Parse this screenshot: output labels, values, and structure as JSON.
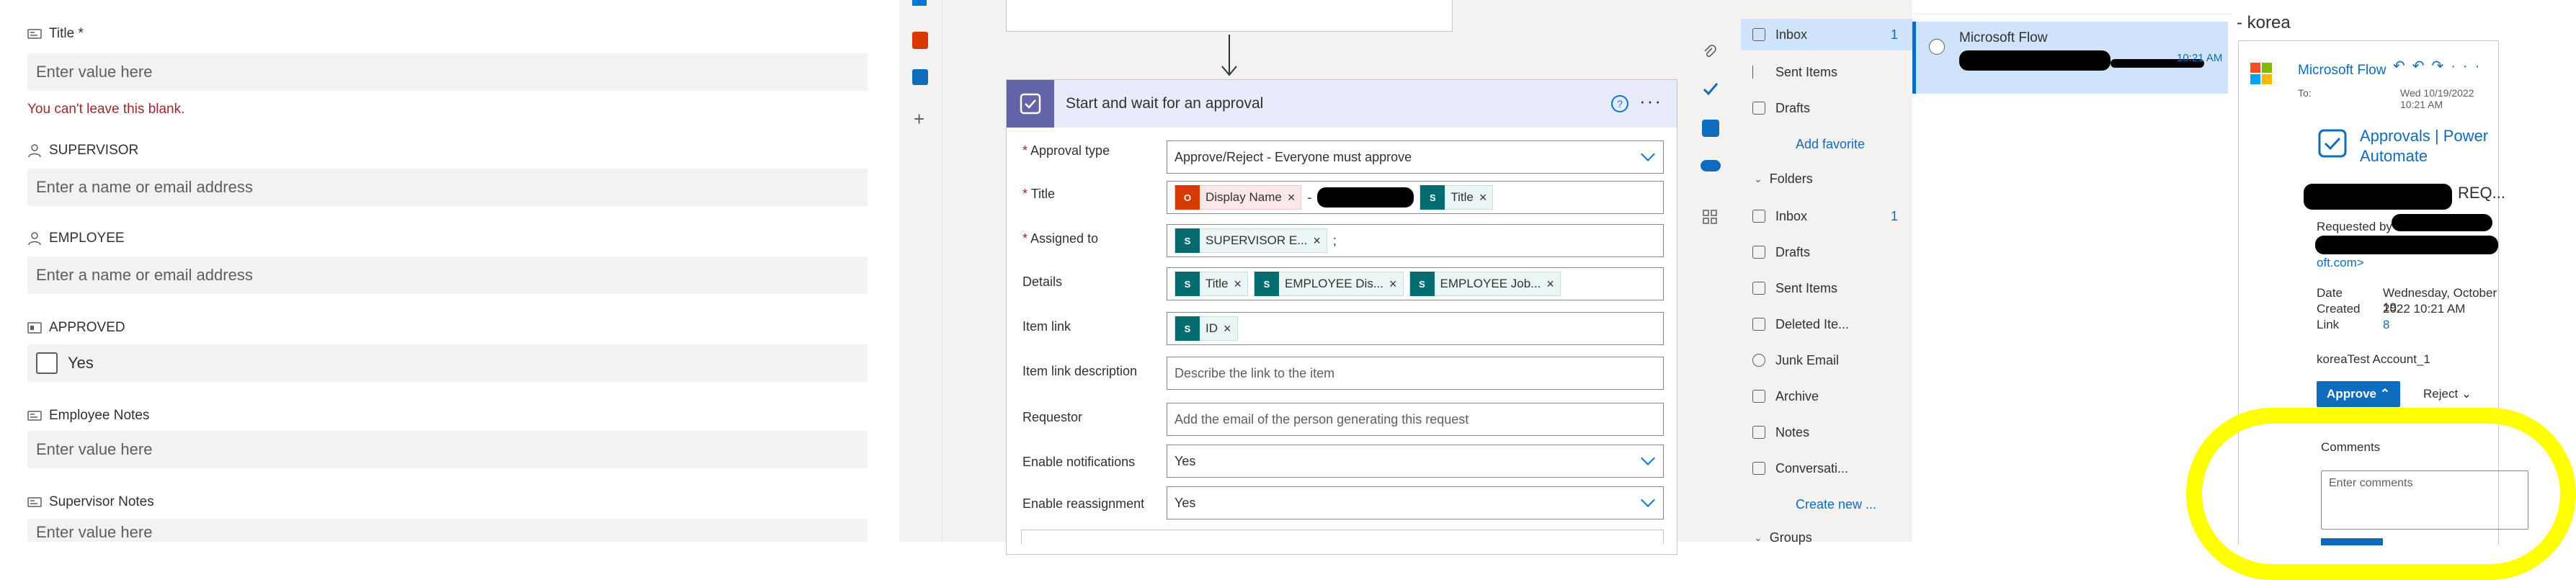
{
  "form": {
    "title_label": "Title *",
    "title_placeholder": "Enter value here",
    "title_error": "You can't leave this blank.",
    "supervisor_label": "SUPERVISOR",
    "supervisor_placeholder": "Enter a name or email address",
    "employee_label": "EMPLOYEE",
    "employee_placeholder": "Enter a name or email address",
    "approved_label": "APPROVED",
    "approved_value": "Yes",
    "employee_notes_label": "Employee Notes",
    "employee_notes_placeholder": "Enter value here",
    "supervisor_notes_label": "Supervisor Notes",
    "supervisor_notes_placeholder": "Enter value here"
  },
  "flow": {
    "action_title": "Start and wait for an approval",
    "rows": {
      "approval_type_label": "Approval type",
      "approval_type_value": "Approve/Reject - Everyone must approve",
      "title_label": "Title",
      "title_token_1": "Display Name",
      "title_sep": "-",
      "title_token_2": "Title",
      "assigned_label": "Assigned to",
      "assigned_token": "SUPERVISOR E...",
      "assigned_suffix": ";",
      "details_label": "Details",
      "details_token_1": "Title",
      "details_token_2": "EMPLOYEE Dis...",
      "details_token_3": "EMPLOYEE Job...",
      "item_link_label": "Item link",
      "item_link_token": "ID",
      "item_link_desc_label": "Item link description",
      "item_link_desc_placeholder": "Describe the link to the item",
      "requestor_label": "Requestor",
      "requestor_placeholder": "Add the email of the person generating this request",
      "notifications_label": "Enable notifications",
      "notifications_value": "Yes",
      "reassignment_label": "Enable reassignment",
      "reassignment_value": "Yes"
    }
  },
  "outlook_nav": {
    "fav_inbox": "Inbox",
    "fav_inbox_count": "1",
    "sent_items": "Sent Items",
    "drafts": "Drafts",
    "add_favorite": "Add favorite",
    "folders_header": "Folders",
    "f_inbox": "Inbox",
    "f_inbox_count": "1",
    "f_drafts": "Drafts",
    "f_sent": "Sent Items",
    "f_deleted": "Deleted Ite...",
    "f_junk": "Junk Email",
    "f_archive": "Archive",
    "f_notes": "Notes",
    "f_conversation": "Conversati...",
    "create_new": "Create new ...",
    "groups_header": "Groups"
  },
  "message_list": {
    "sender": "Microsoft Flow",
    "time": "10:21 AM"
  },
  "reading_pane": {
    "subject_fragment": "- korea",
    "from": "Microsoft Flow",
    "to_label": "To:",
    "date": "Wed 10/19/2022 10:21 AM",
    "card_title": "Approvals | Power Automate",
    "req_fragment": "REQ...",
    "requested_by_label": "Requested by",
    "email_fragment": "oft.com>",
    "date_created_label_1": "Date",
    "date_created_label_2": "Created",
    "date_created_value_1": "Wednesday, October 19,",
    "date_created_value_2": "2022 10:21 AM",
    "link_label": "Link",
    "link_value": "8",
    "account_name": "koreaTest Account_1",
    "approve_label": "Approve",
    "reject_label": "Reject",
    "comments_label": "Comments",
    "comments_placeholder": "Enter comments"
  },
  "colors": {
    "accent": "#0f6cbd",
    "highlight": "#ffff00",
    "error": "#a4262c",
    "sharepoint_token": "#036c70",
    "office_token": "#d83b01"
  }
}
